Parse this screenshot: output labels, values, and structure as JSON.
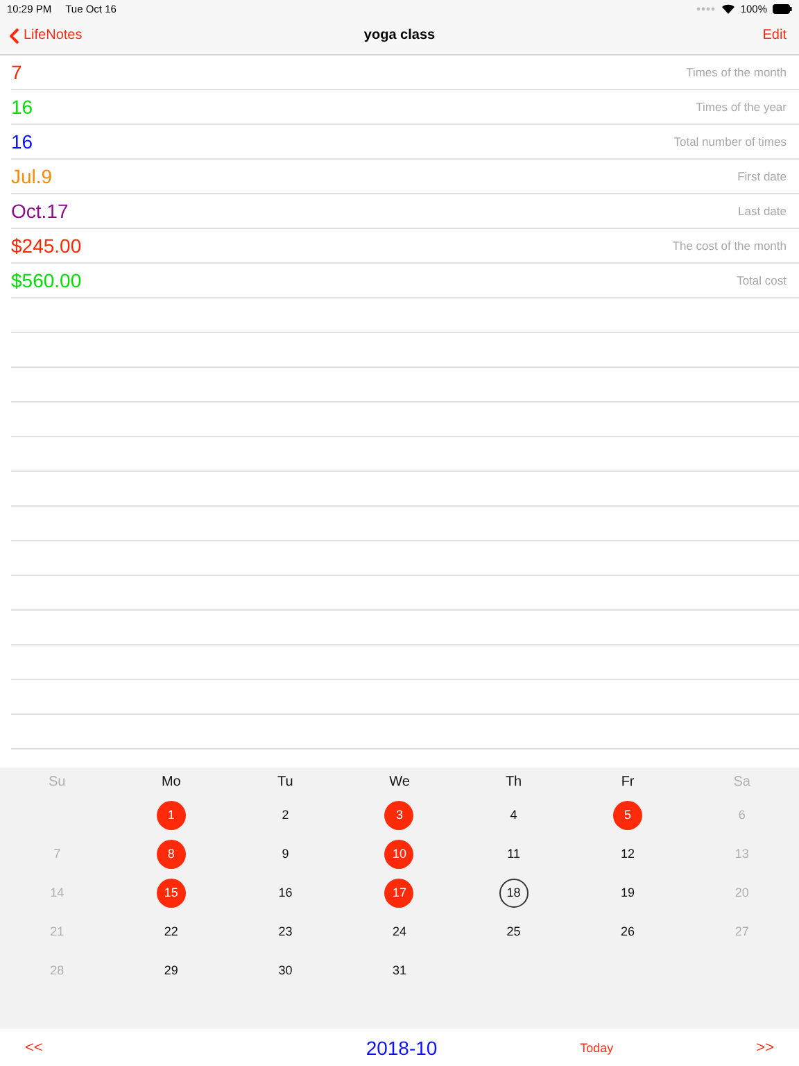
{
  "status_bar": {
    "time": "10:29 PM",
    "date": "Tue Oct 16",
    "battery": "100%"
  },
  "nav": {
    "back": "LifeNotes",
    "title": "yoga class",
    "action": "Edit"
  },
  "stats": [
    {
      "value": "7",
      "label": "Times of the month",
      "color": "#ff2600"
    },
    {
      "value": "16",
      "label": "Times of the year",
      "color": "#00dd00"
    },
    {
      "value": "16",
      "label": "Total number of times",
      "color": "#0a10ff"
    },
    {
      "value": "Jul.9",
      "label": "First date",
      "color": "#ff8800"
    },
    {
      "value": "Oct.17",
      "label": "Last date",
      "color": "#8a0f8a"
    },
    {
      "value": "$245.00",
      "label": "The cost of the month",
      "color": "#ff2600"
    },
    {
      "value": "$560.00",
      "label": "Total cost",
      "color": "#00dd00"
    }
  ],
  "calendar": {
    "weekdays": [
      "Su",
      "Mo",
      "Tu",
      "We",
      "Th",
      "Fr",
      "Sa"
    ],
    "weeks": [
      {
        "days": [
          {
            "day": "1",
            "marked": true,
            "today": false
          },
          {
            "day": "2",
            "marked": false,
            "today": false
          },
          {
            "day": "3",
            "marked": true,
            "today": false
          },
          {
            "day": "4",
            "marked": false,
            "today": false
          },
          {
            "day": "5",
            "marked": true,
            "today": false
          },
          {
            "day": "6",
            "marked": false,
            "today": false
          }
        ]
      },
      {
        "days": [
          {
            "day": "7",
            "marked": false,
            "today": false
          },
          {
            "day": "8",
            "marked": true,
            "today": false
          },
          {
            "day": "9",
            "marked": false,
            "today": false
          },
          {
            "day": "10",
            "marked": true,
            "today": false
          },
          {
            "day": "11",
            "marked": false,
            "today": false
          },
          {
            "day": "12",
            "marked": false,
            "today": false
          },
          {
            "day": "13",
            "marked": false,
            "today": false
          }
        ]
      },
      {
        "days": [
          {
            "day": "14",
            "marked": false,
            "today": false
          },
          {
            "day": "15",
            "marked": true,
            "today": false
          },
          {
            "day": "16",
            "marked": false,
            "today": false
          },
          {
            "day": "17",
            "marked": true,
            "today": false
          },
          {
            "day": "18",
            "marked": false,
            "today": true
          },
          {
            "day": "19",
            "marked": false,
            "today": false
          },
          {
            "day": "20",
            "marked": false,
            "today": false
          }
        ]
      },
      {
        "days": [
          {
            "day": "21",
            "marked": false,
            "today": false
          },
          {
            "day": "22",
            "marked": false,
            "today": false
          },
          {
            "day": "23",
            "marked": false,
            "today": false
          },
          {
            "day": "24",
            "marked": false,
            "today": false
          },
          {
            "day": "25",
            "marked": false,
            "today": false
          },
          {
            "day": "26",
            "marked": false,
            "today": false
          },
          {
            "day": "27",
            "marked": false,
            "today": false
          }
        ]
      },
      {
        "days": [
          {
            "day": "28",
            "marked": false,
            "today": false
          },
          {
            "day": "29",
            "marked": false,
            "today": false
          },
          {
            "day": "30",
            "marked": false,
            "today": false
          },
          {
            "day": "31",
            "marked": false,
            "today": false
          }
        ]
      }
    ]
  },
  "footer": {
    "prev": "<<",
    "month": "2018-10",
    "today": "Today",
    "next": ">>"
  }
}
